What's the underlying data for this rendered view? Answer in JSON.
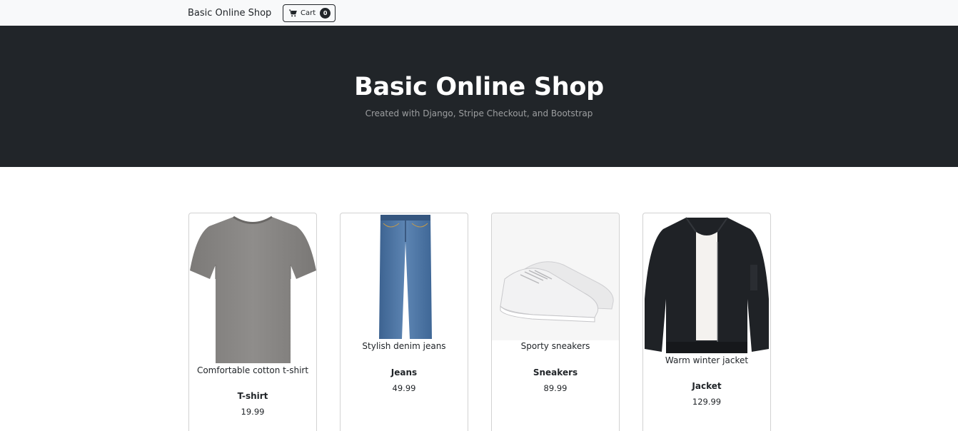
{
  "navbar": {
    "brand": "Basic Online Shop",
    "cart_label": "Cart",
    "cart_count": "0"
  },
  "hero": {
    "title": "Basic Online Shop",
    "subtitle": "Created with Django, Stripe Checkout, and Bootstrap"
  },
  "products": [
    {
      "description": "Comfortable cotton t-shirt",
      "name": "T-shirt",
      "price": "19.99",
      "image_icon": "tshirt-image"
    },
    {
      "description": "Stylish denim jeans",
      "name": "Jeans",
      "price": "49.99",
      "image_icon": "jeans-image"
    },
    {
      "description": "Sporty sneakers",
      "name": "Sneakers",
      "price": "89.99",
      "image_icon": "sneakers-image"
    },
    {
      "description": "Warm winter jacket",
      "name": "Jacket",
      "price": "129.99",
      "image_icon": "jacket-image"
    }
  ],
  "colors": {
    "hero_bg": "#212529",
    "navbar_bg": "#f8f9fa",
    "tshirt": "#8a8886",
    "denim": "#4a72a0",
    "jacket": "#1f2226"
  }
}
